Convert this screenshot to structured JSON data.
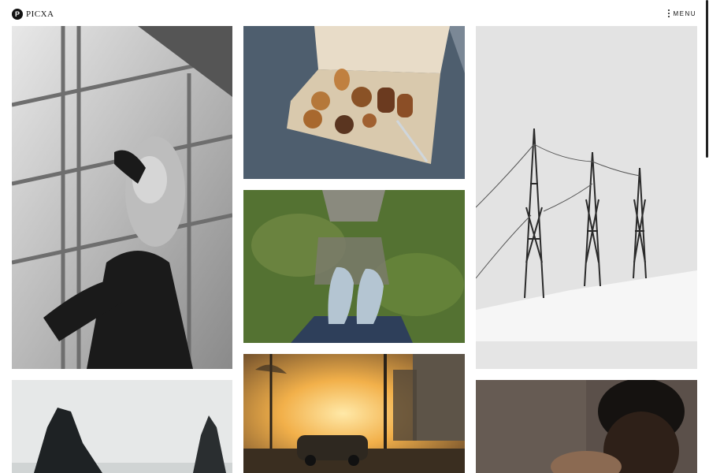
{
  "header": {
    "logo_initial": "P",
    "logo_text": "PICXA",
    "menu_label": "MENU"
  }
}
